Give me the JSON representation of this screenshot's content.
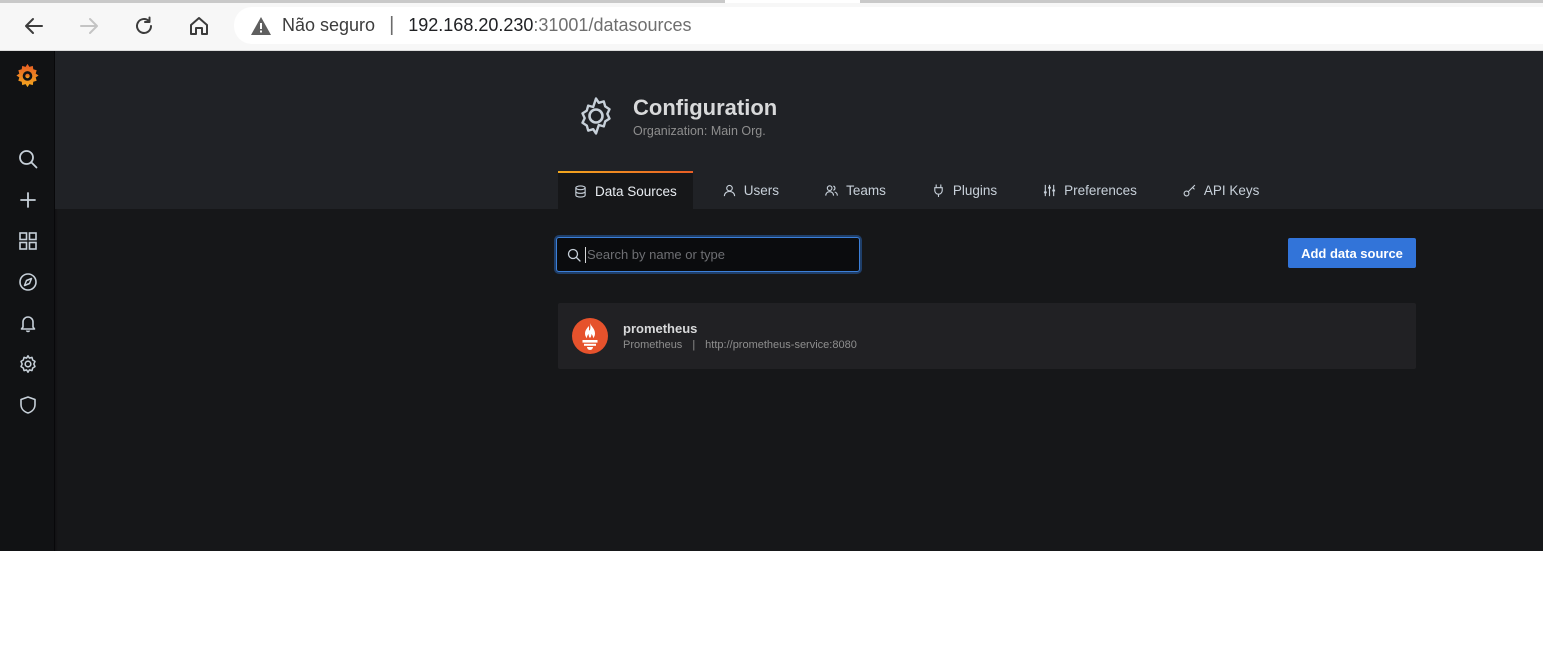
{
  "browser": {
    "security_label": "Não seguro",
    "separator": "|",
    "url_host": "192.168.20.230",
    "url_path": ":31001/datasources"
  },
  "header": {
    "title": "Configuration",
    "subtitle": "Organization: Main Org."
  },
  "tabs": [
    {
      "label": "Data Sources",
      "icon": "database-icon",
      "active": true
    },
    {
      "label": "Users",
      "icon": "user-icon",
      "active": false
    },
    {
      "label": "Teams",
      "icon": "users-icon",
      "active": false
    },
    {
      "label": "Plugins",
      "icon": "plug-icon",
      "active": false
    },
    {
      "label": "Preferences",
      "icon": "sliders-icon",
      "active": false
    },
    {
      "label": "API Keys",
      "icon": "key-icon",
      "active": false
    }
  ],
  "search": {
    "placeholder": "Search by name or type",
    "value": ""
  },
  "actions": {
    "add_label": "Add data source"
  },
  "datasources": [
    {
      "name": "prometheus",
      "type": "Prometheus",
      "separator": "|",
      "url": "http://prometheus-service:8080"
    }
  ],
  "sidebar": {
    "items": [
      "search-icon",
      "plus-icon",
      "dashboards-icon",
      "explore-icon",
      "alerting-icon",
      "configuration-icon",
      "shield-icon"
    ]
  },
  "colors": {
    "accent_blue": "#3274d9",
    "grafana_orange": "#f3a81e",
    "prometheus_red": "#e6522c"
  }
}
